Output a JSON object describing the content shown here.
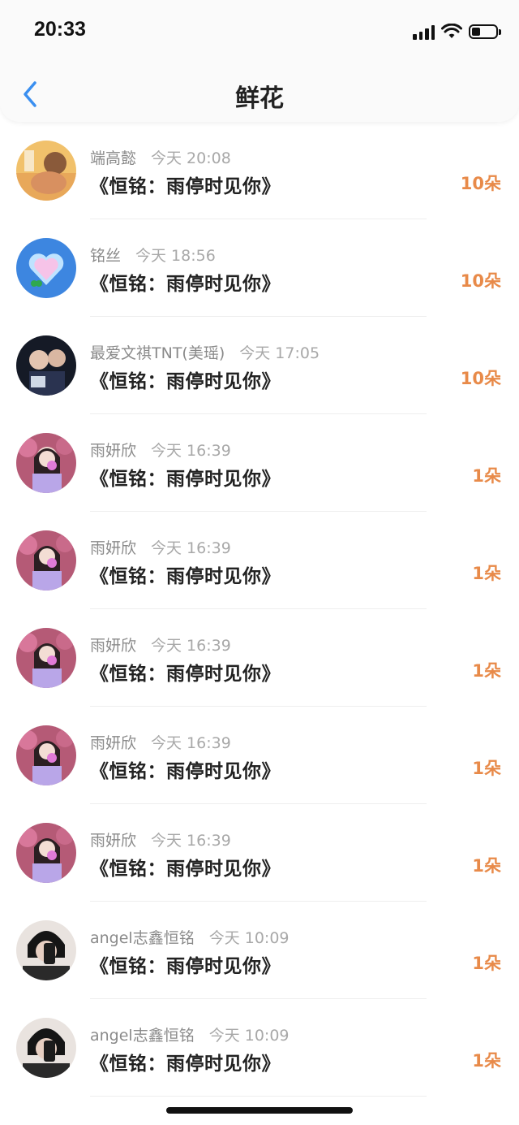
{
  "status_bar": {
    "time": "20:33"
  },
  "nav": {
    "title": "鲜花"
  },
  "list": [
    {
      "name": "端高懿",
      "time": "今天 20:08",
      "book": "《恒铭：雨停时见你》",
      "count": "10朵",
      "avatar": "avatar-a"
    },
    {
      "name": "铭丝",
      "time": "今天 18:56",
      "book": "《恒铭：雨停时见你》",
      "count": "10朵",
      "avatar": "avatar-b"
    },
    {
      "name": "最爱文祺TNT(美瑶)",
      "time": "今天 17:05",
      "book": "《恒铭：雨停时见你》",
      "count": "10朵",
      "avatar": "avatar-c"
    },
    {
      "name": "雨妍欣",
      "time": "今天 16:39",
      "book": "《恒铭：雨停时见你》",
      "count": "1朵",
      "avatar": "avatar-d"
    },
    {
      "name": "雨妍欣",
      "time": "今天 16:39",
      "book": "《恒铭：雨停时见你》",
      "count": "1朵",
      "avatar": "avatar-d"
    },
    {
      "name": "雨妍欣",
      "time": "今天 16:39",
      "book": "《恒铭：雨停时见你》",
      "count": "1朵",
      "avatar": "avatar-d"
    },
    {
      "name": "雨妍欣",
      "time": "今天 16:39",
      "book": "《恒铭：雨停时见你》",
      "count": "1朵",
      "avatar": "avatar-d"
    },
    {
      "name": "雨妍欣",
      "time": "今天 16:39",
      "book": "《恒铭：雨停时见你》",
      "count": "1朵",
      "avatar": "avatar-d"
    },
    {
      "name": "angel志鑫恒铭",
      "time": "今天 10:09",
      "book": "《恒铭：雨停时见你》",
      "count": "1朵",
      "avatar": "avatar-e"
    },
    {
      "name": "angel志鑫恒铭",
      "time": "今天 10:09",
      "book": "《恒铭：雨停时见你》",
      "count": "1朵",
      "avatar": "avatar-e"
    }
  ]
}
